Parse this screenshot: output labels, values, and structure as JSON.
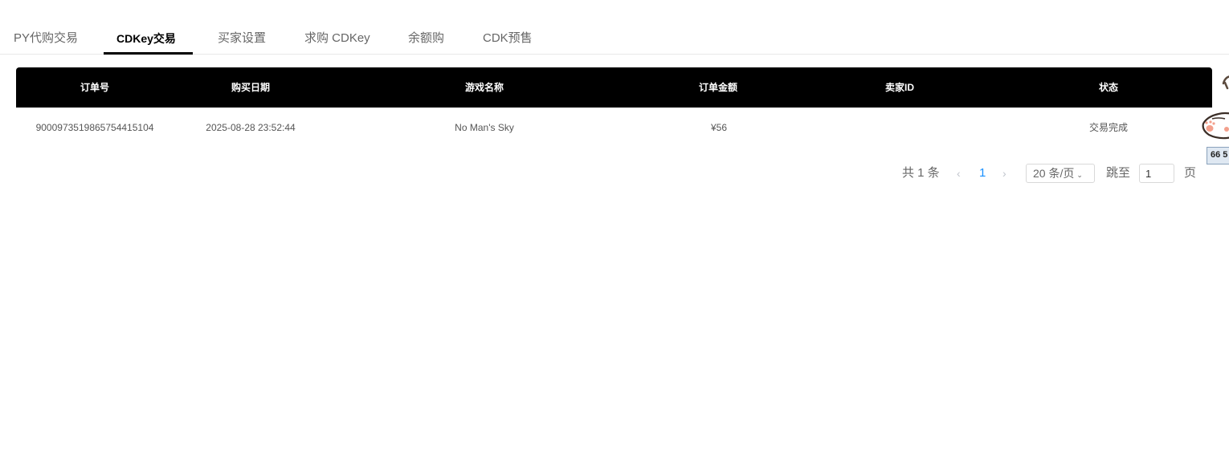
{
  "tabs": [
    {
      "label": "PY代购交易",
      "active": false
    },
    {
      "label": "CDKey交易",
      "active": true
    },
    {
      "label": "买家设置",
      "active": false
    },
    {
      "label": "求购 CDKey",
      "active": false
    },
    {
      "label": "余额购",
      "active": false
    },
    {
      "label": "CDK预售",
      "active": false
    }
  ],
  "table": {
    "headers": [
      "订单号",
      "购买日期",
      "游戏名称",
      "订单金额",
      "卖家ID",
      "状态"
    ],
    "rows": [
      [
        "9000973519865754415104",
        "2025-08-28 23:52:44",
        "No Man's Sky",
        "¥56",
        "",
        "交易完成"
      ]
    ]
  },
  "pagination": {
    "total": "共 1 条",
    "current_page": "1",
    "prev_icon": "chevron-left-icon",
    "next_icon": "chevron-right-icon",
    "page_size": "20 条/页",
    "jump_label": "跳至",
    "jump_value": "1",
    "page_unit": "页"
  },
  "overlay": {
    "badge": "66 5"
  },
  "colors": {
    "header_bg": "#000000",
    "active_tab": "#000000",
    "link_blue": "#1890ff"
  }
}
